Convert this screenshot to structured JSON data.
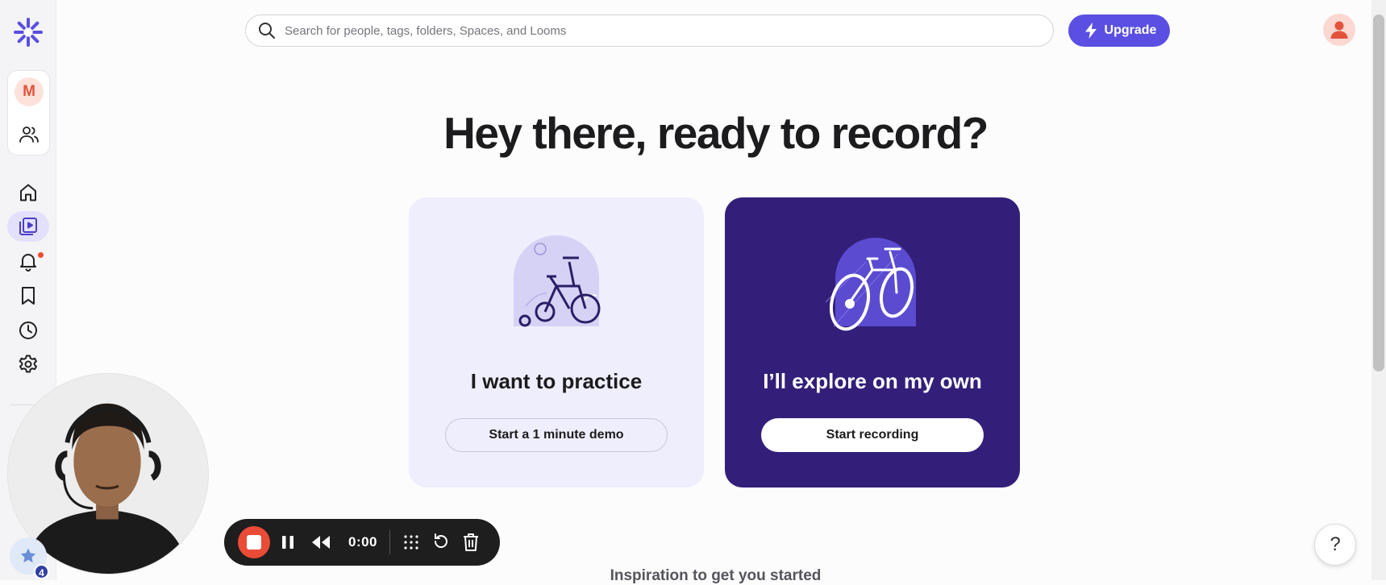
{
  "sidebar": {
    "workspace_initial": "M",
    "nav_items": [
      {
        "name": "home",
        "icon": "home-icon"
      },
      {
        "name": "library",
        "icon": "video-library-icon",
        "active": true
      },
      {
        "name": "notifications",
        "icon": "bell-icon",
        "has_dot": true
      },
      {
        "name": "bookmarks",
        "icon": "bookmark-icon"
      },
      {
        "name": "history",
        "icon": "clock-icon"
      },
      {
        "name": "settings",
        "icon": "gear-icon"
      }
    ]
  },
  "header": {
    "search_placeholder": "Search for people, tags, folders, Spaces, and Looms",
    "upgrade_label": "Upgrade"
  },
  "main": {
    "title": "Hey there, ready to record?",
    "cards": {
      "practice": {
        "title": "I want to practice",
        "button": "Start a 1 minute demo"
      },
      "explore": {
        "title": "I’ll explore on my own",
        "button": "Start recording"
      }
    },
    "inspiration": "Inspiration to get you started"
  },
  "recorder": {
    "time": "0:00",
    "badge_count": "4"
  },
  "help_label": "?",
  "colors": {
    "accent": "#5a4fe2",
    "explore_card": "#331f79",
    "practice_card": "#efeefc",
    "record_red": "#ea4b36"
  }
}
